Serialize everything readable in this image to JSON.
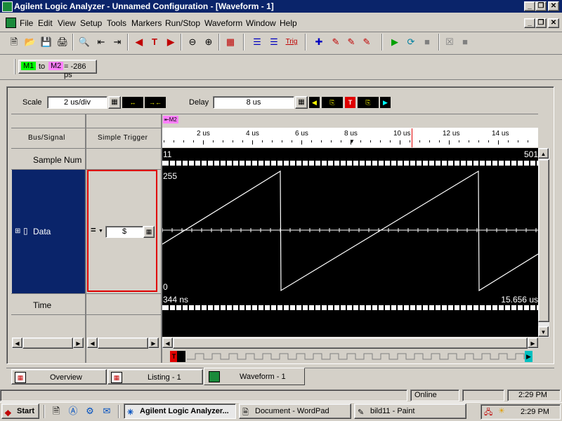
{
  "window": {
    "title": "Agilent Logic Analyzer  -  Unnamed Configuration - [Waveform - 1]"
  },
  "menu": [
    "File",
    "Edit",
    "View",
    "Setup",
    "Tools",
    "Markers",
    "Run/Stop",
    "Waveform",
    "Window",
    "Help"
  ],
  "toolbar": {
    "trig_label": "Trig"
  },
  "marker_bar": {
    "m1": "M1",
    "to": "to",
    "m2": "M2",
    "value": "= -286 ps"
  },
  "controls": {
    "scale_label": "Scale",
    "scale_value": "2 us/div",
    "delay_label": "Delay",
    "delay_value": "8 us"
  },
  "columns": {
    "bus_signal": "Bus/Signal",
    "simple_trigger": "Simple Trigger"
  },
  "rows": {
    "sample_num": "Sample Num",
    "data": "Data",
    "time": "Time"
  },
  "trigger": {
    "op": "=",
    "value": "$"
  },
  "marker_m2_label": "M2",
  "ruler": {
    "ticks": [
      "2 us",
      "4 us",
      "6 us",
      "8 us",
      "10 us",
      "12 us",
      "14 us"
    ]
  },
  "waveform": {
    "sample_start": "11",
    "sample_end": "501",
    "y_max": "255",
    "y_min": "0",
    "time_start": "344 ns",
    "time_end": "15.656 us"
  },
  "tabs": [
    "Overview",
    "Listing - 1",
    "Waveform - 1"
  ],
  "status": {
    "online": "Online",
    "time": "2:29 PM"
  },
  "taskbar": {
    "start": "Start",
    "items": [
      "Agilent Logic Analyzer...",
      "Document - WordPad",
      "bild11 - Paint"
    ],
    "clock": "2:29 PM"
  },
  "colors": {
    "title_bg": "#0a246a",
    "selection": "#0a246a",
    "marker_m1": "#00ff00",
    "marker_m2": "#ff80ff",
    "trigger_border": "#e00000",
    "cursor_line": "#e00000"
  }
}
